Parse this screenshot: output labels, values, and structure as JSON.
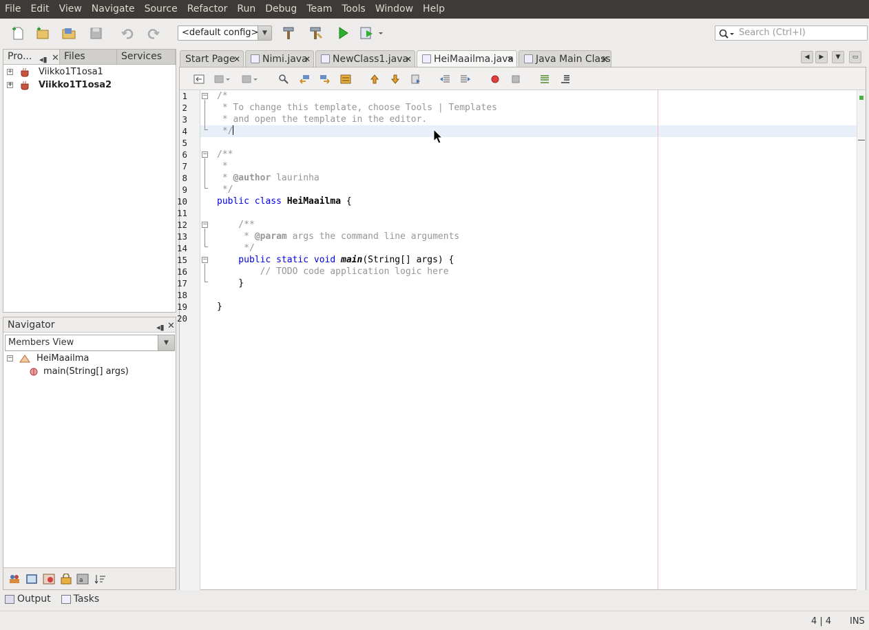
{
  "menubar": {
    "items": [
      "File",
      "Edit",
      "View",
      "Navigate",
      "Source",
      "Refactor",
      "Run",
      "Debug",
      "Team",
      "Tools",
      "Window",
      "Help"
    ]
  },
  "toolbar": {
    "config_label": "<default config>",
    "search_placeholder": "Search (Ctrl+I)"
  },
  "projects_pane": {
    "tabs": [
      "Pro...",
      "Files",
      "Services"
    ],
    "projects": [
      "Viikko1T1osa1",
      "Viikko1T1osa2"
    ]
  },
  "navigator": {
    "title": "Navigator",
    "view_select": "Members View",
    "class_name": "HeiMaailma",
    "member": "main(String[] args)"
  },
  "editor": {
    "tabs": [
      "Start Page",
      "Nimi.java",
      "NewClass1.java",
      "HeiMaailma.java",
      "Java Main Class"
    ],
    "active_tab": "HeiMaailma.java",
    "line_numbers": [
      "1",
      "2",
      "3",
      "4",
      "5",
      "6",
      "7",
      "8",
      "9",
      "10",
      "11",
      "12",
      "13",
      "14",
      "15",
      "16",
      "17",
      "18",
      "19",
      "20"
    ],
    "code": {
      "l1": "/*",
      "l2": " * To change this template, choose Tools | Templates",
      "l3": " * and open the template in the editor.",
      "l4": " */",
      "l6": "/**",
      "l7": " *",
      "l8_tag": "@author",
      "l8_text": " laurinha",
      "l9": " */",
      "l10_kw": "public class ",
      "l10_name": "HeiMaailma",
      "l10_rest": " {",
      "l12": "    /**",
      "l13_pre": "     * ",
      "l13_tag": "@param",
      "l13_text": " args the command line arguments",
      "l14": "     */",
      "l15_kw": "    public static void ",
      "l15_name": "main",
      "l15_rest": "(String[] args) {",
      "l16": "        // TODO code application logic here",
      "l17": "    }",
      "l19": "}"
    }
  },
  "bottom": {
    "output_label": "Output",
    "tasks_label": "Tasks"
  },
  "status": {
    "position": "4 | 4",
    "mode": "INS"
  },
  "colors": {
    "menubar_bg": "#3c3b37",
    "keyword": "#0000e6",
    "comment": "#969696",
    "current_line": "#e9eff8"
  }
}
